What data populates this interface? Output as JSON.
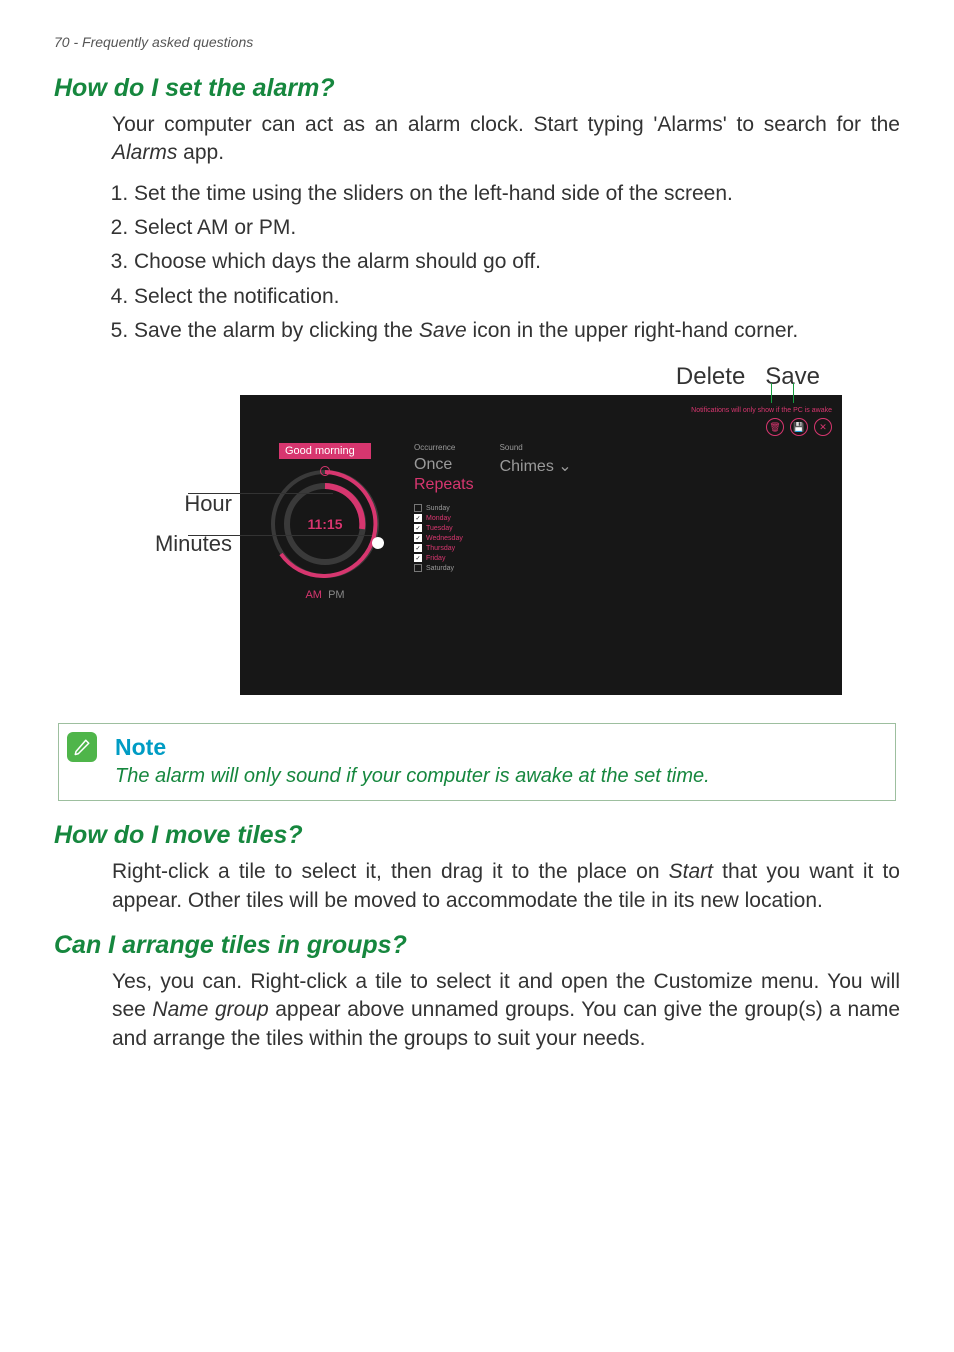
{
  "header": {
    "line": "70 - Frequently asked questions"
  },
  "q1": {
    "title": "How do I set the alarm?",
    "intro_a": "Your computer can act as an alarm clock. Start typing 'Alarms' to search for the ",
    "intro_em": "Alarms",
    "intro_b": " app.",
    "steps": {
      "s1": "Set the time using the sliders on the left-hand side of the screen.",
      "s2": "Select AM or PM.",
      "s3": "Choose which days the alarm should go off.",
      "s4": "Select the notification.",
      "s5a": "Save the alarm by clicking the ",
      "s5em": "Save",
      "s5b": " icon in the upper right-hand corner."
    }
  },
  "figure": {
    "top_labels": {
      "delete": "Delete",
      "save": "Save"
    },
    "left_labels": {
      "hour": "Hour",
      "minutes": "Minutes"
    },
    "alarm": {
      "notif_text": "Notifications will only show if the PC is awake",
      "name": "Good morning",
      "time": "11:15",
      "am": "AM",
      "pm": "PM",
      "occurrence_head": "Occurrence",
      "once": "Once",
      "repeats": "Repeats",
      "days": {
        "sun": {
          "label": "Sunday",
          "checked": false
        },
        "mon": {
          "label": "Monday",
          "checked": true
        },
        "tue": {
          "label": "Tuesday",
          "checked": true
        },
        "wed": {
          "label": "Wednesday",
          "checked": true
        },
        "thu": {
          "label": "Thursday",
          "checked": true
        },
        "fri": {
          "label": "Friday",
          "checked": true
        },
        "sat": {
          "label": "Saturday",
          "checked": false
        }
      },
      "sound_head": "Sound",
      "sound_value": "Chimes ⌄"
    }
  },
  "note": {
    "title": "Note",
    "text": "The alarm will only sound if your computer is awake at the set time."
  },
  "q2": {
    "title": "How do I move tiles?",
    "body_a": "Right-click a tile to select it, then drag it to the place on ",
    "body_em": "Start",
    "body_b": " that you want it to appear. Other tiles will be moved to accommodate the tile in its new location."
  },
  "q3": {
    "title": "Can I arrange tiles in groups?",
    "body_a": "Yes, you can. Right-click a tile to select it and open the Customize menu. You will see ",
    "body_em": "Name group",
    "body_b": " appear above unnamed groups. You can give the group(s) a name and arrange the tiles within the groups to suit your needs."
  }
}
